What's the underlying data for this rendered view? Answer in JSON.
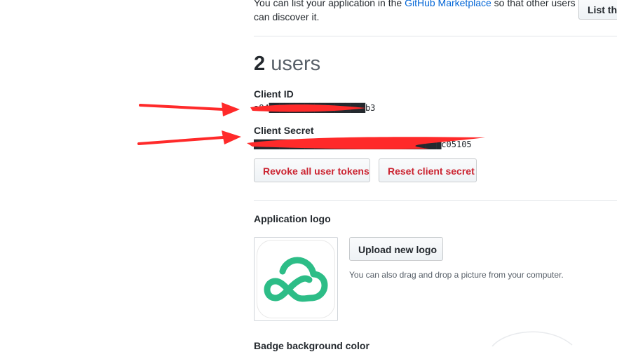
{
  "marketplace": {
    "text_before": "You can list your application in the ",
    "link": "GitHub Marketplace",
    "text_after": " so that other users can discover it.",
    "button": "List thi"
  },
  "users": {
    "count": "2",
    "label": "users"
  },
  "credentials": {
    "client_id_label": "Client ID",
    "client_id_value": "a84███████████████████b3",
    "client_secret_label": "Client Secret",
    "client_secret_value": "█████████████████████████████████████c05105",
    "revoke_button": "Revoke all user tokens",
    "reset_button": "Reset client secret"
  },
  "logo_section": {
    "title": "Application logo",
    "upload_button": "Upload new logo",
    "hint": "You can also drag and drop a picture from your computer."
  },
  "badge_section": {
    "title": "Badge background color"
  },
  "colors": {
    "link": "#0366d6",
    "danger": "#cb2431",
    "logo_green": "#2dbd87",
    "annotation_red": "#ff2a2a"
  }
}
